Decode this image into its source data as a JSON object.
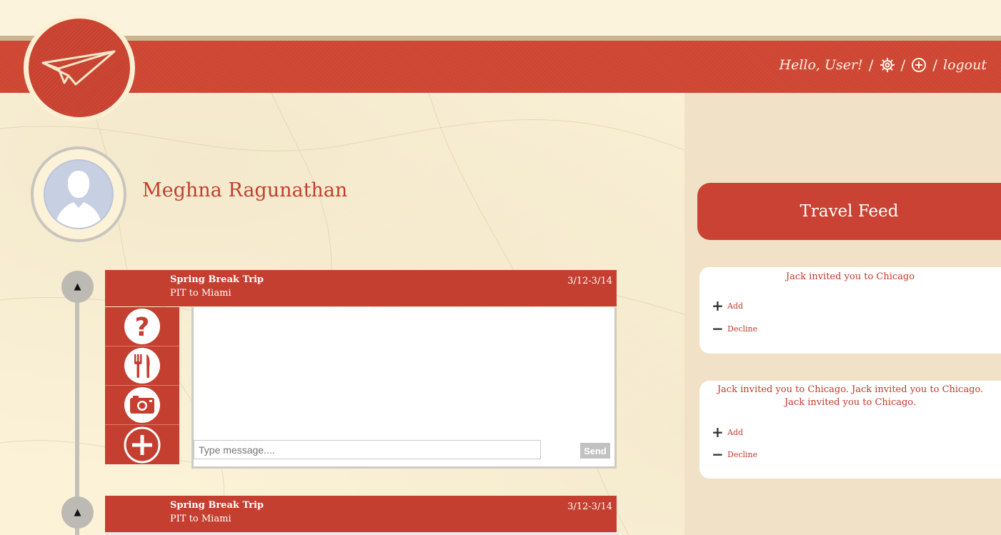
{
  "header": {
    "greeting": "Hello, User!",
    "separator": "/",
    "logout_label": "logout",
    "settings_icon": "gear-icon",
    "add_icon": "plus-circle-icon",
    "logo_icon": "paper-plane-icon"
  },
  "profile": {
    "name": "Meghna Ragunathan",
    "avatar_icon": "default-avatar-icon"
  },
  "trips": [
    {
      "title": "Spring Break Trip",
      "route": "PIT to Miami",
      "dates": "3/12-3/14",
      "collapse_icon": "triangle-up-icon",
      "tools": [
        "question-icon",
        "fork-knife-icon",
        "camera-icon",
        "plus-circle-icon"
      ],
      "chat": {
        "placeholder": "Type message....",
        "value": "",
        "send_label": "Send"
      }
    },
    {
      "title": "Spring Break Trip",
      "route": "PIT to Miami",
      "dates": "3/12-3/14",
      "collapse_icon": "triangle-up-icon"
    }
  ],
  "feed": {
    "title": "Travel Feed",
    "items": [
      {
        "message": "Jack invited you to Chicago",
        "add_label": "Add",
        "decline_label": "Decline"
      },
      {
        "message": "Jack invited you to Chicago. Jack invited you to Chicago. Jack invited you to Chicago.",
        "add_label": "Add",
        "decline_label": "Decline"
      }
    ]
  },
  "colors": {
    "brand_red": "#c43f30",
    "background": "#fbf2d8",
    "sidebar": "#f0e1c7"
  }
}
